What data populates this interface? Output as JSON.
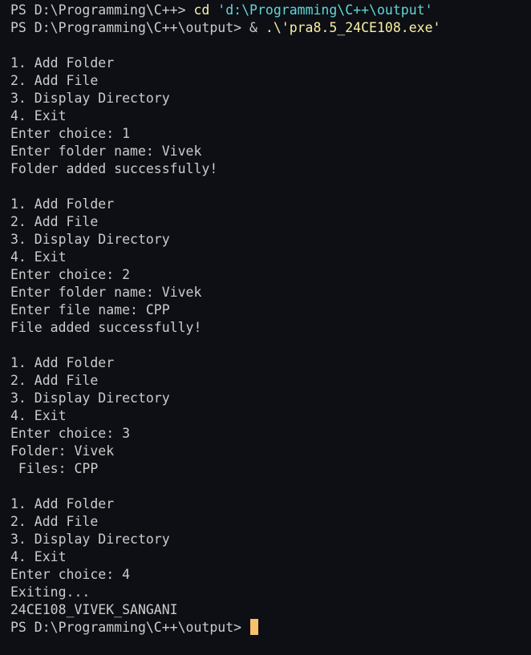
{
  "colors": {
    "background": "#0d0f14",
    "text": "#cccccc",
    "command": "#f9f1a5",
    "string": "#61d6d6",
    "cursor": "#f9c06b"
  },
  "terminal": {
    "lines": [
      {
        "segments": [
          {
            "text": "PS D:\\Programming\\C++> ",
            "color": "text"
          },
          {
            "text": "cd",
            "color": "command"
          },
          {
            "text": " ",
            "color": "text"
          },
          {
            "text": "'d:\\Programming\\C++\\output'",
            "color": "string"
          }
        ]
      },
      {
        "segments": [
          {
            "text": "PS D:\\Programming\\C++\\output> ",
            "color": "text"
          },
          {
            "text": "& ",
            "color": "text"
          },
          {
            "text": ".\\'pra8.5_24CE108.exe'",
            "color": "command"
          }
        ]
      },
      {
        "segments": [
          {
            "text": "",
            "color": "text"
          }
        ]
      },
      {
        "segments": [
          {
            "text": "1. Add Folder",
            "color": "text"
          }
        ]
      },
      {
        "segments": [
          {
            "text": "2. Add File",
            "color": "text"
          }
        ]
      },
      {
        "segments": [
          {
            "text": "3. Display Directory",
            "color": "text"
          }
        ]
      },
      {
        "segments": [
          {
            "text": "4. Exit",
            "color": "text"
          }
        ]
      },
      {
        "segments": [
          {
            "text": "Enter choice: 1",
            "color": "text"
          }
        ]
      },
      {
        "segments": [
          {
            "text": "Enter folder name: Vivek",
            "color": "text"
          }
        ]
      },
      {
        "segments": [
          {
            "text": "Folder added successfully!",
            "color": "text"
          }
        ]
      },
      {
        "segments": [
          {
            "text": "",
            "color": "text"
          }
        ]
      },
      {
        "segments": [
          {
            "text": "1. Add Folder",
            "color": "text"
          }
        ]
      },
      {
        "segments": [
          {
            "text": "2. Add File",
            "color": "text"
          }
        ]
      },
      {
        "segments": [
          {
            "text": "3. Display Directory",
            "color": "text"
          }
        ]
      },
      {
        "segments": [
          {
            "text": "4. Exit",
            "color": "text"
          }
        ]
      },
      {
        "segments": [
          {
            "text": "Enter choice: 2",
            "color": "text"
          }
        ]
      },
      {
        "segments": [
          {
            "text": "Enter folder name: Vivek",
            "color": "text"
          }
        ]
      },
      {
        "segments": [
          {
            "text": "Enter file name: CPP",
            "color": "text"
          }
        ]
      },
      {
        "segments": [
          {
            "text": "File added successfully!",
            "color": "text"
          }
        ]
      },
      {
        "segments": [
          {
            "text": "",
            "color": "text"
          }
        ]
      },
      {
        "segments": [
          {
            "text": "1. Add Folder",
            "color": "text"
          }
        ]
      },
      {
        "segments": [
          {
            "text": "2. Add File",
            "color": "text"
          }
        ]
      },
      {
        "segments": [
          {
            "text": "3. Display Directory",
            "color": "text"
          }
        ]
      },
      {
        "segments": [
          {
            "text": "4. Exit",
            "color": "text"
          }
        ]
      },
      {
        "segments": [
          {
            "text": "Enter choice: 3",
            "color": "text"
          }
        ]
      },
      {
        "segments": [
          {
            "text": "Folder: Vivek",
            "color": "text"
          }
        ]
      },
      {
        "segments": [
          {
            "text": " Files: CPP",
            "color": "text"
          }
        ]
      },
      {
        "segments": [
          {
            "text": "",
            "color": "text"
          }
        ]
      },
      {
        "segments": [
          {
            "text": "1. Add Folder",
            "color": "text"
          }
        ]
      },
      {
        "segments": [
          {
            "text": "2. Add File",
            "color": "text"
          }
        ]
      },
      {
        "segments": [
          {
            "text": "3. Display Directory",
            "color": "text"
          }
        ]
      },
      {
        "segments": [
          {
            "text": "4. Exit",
            "color": "text"
          }
        ]
      },
      {
        "segments": [
          {
            "text": "Enter choice: 4",
            "color": "text"
          }
        ]
      },
      {
        "segments": [
          {
            "text": "Exiting...",
            "color": "text"
          }
        ]
      },
      {
        "segments": [
          {
            "text": "24CE108_VIVEK_SANGANI",
            "color": "text"
          }
        ]
      },
      {
        "segments": [
          {
            "text": "PS D:\\Programming\\C++\\output> ",
            "color": "text"
          }
        ],
        "cursor": true
      }
    ]
  }
}
